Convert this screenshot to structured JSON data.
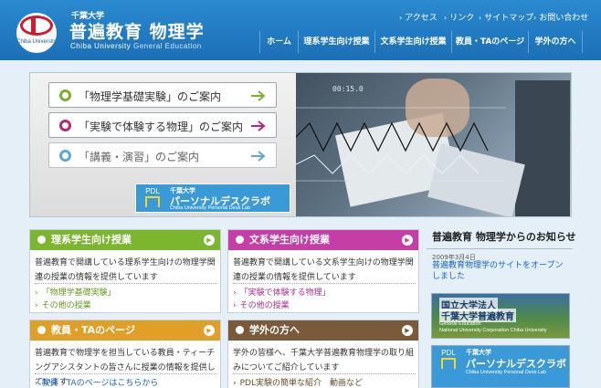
{
  "header": {
    "logo_text": "Chiba University",
    "univ_name": "千葉大学",
    "title": "普遍教育  物理学",
    "subtitle_en": "Chiba University",
    "subtitle_en2": "General Education",
    "util_links": [
      "アクセス",
      "リンク",
      "サイトマップ",
      "お問い合わせ"
    ],
    "nav": [
      "ホーム",
      "理系学生向け授業",
      "文系学生向け授業",
      "教員・TAのページ",
      "学外の方へ"
    ]
  },
  "hero": {
    "buttons": [
      {
        "label": "「物理学基礎実験」のご案内",
        "color": "#7ab02e"
      },
      {
        "label": "「実験で体験する物理」のご案内",
        "color": "#b4287a"
      },
      {
        "label": "「講義・演習」のご案内",
        "color": "#5aa8d8"
      }
    ],
    "pdl": {
      "logo": "PDL",
      "small": "千葉大学",
      "big": "パーソナルデスクラボ",
      "en": "Chiba University Personal Desk Lab"
    },
    "photo_readout": "00:15.0"
  },
  "boxes": [
    {
      "title": "理系学生向け授業",
      "color": "#7cb52e",
      "text": "普遍教育で開講している理系学生向けの物理学関連の授業の情報を提供しています",
      "links": [
        "「物理学基礎実験」",
        "その他の授業"
      ]
    },
    {
      "title": "文系学生向け授業",
      "color": "#c43ea6",
      "text": "普遍教育で開講している文系学生向けの物理学関連の授業の情報を提供しています",
      "links": [
        "「実験で体験する物理」",
        "その他の授業"
      ]
    },
    {
      "title": "教員・TAのページ",
      "color": "#e0a028",
      "text": "普遍教育で物理学を担当している教員・ティーチングアシスタントの皆さんに授業の情報を提供しています",
      "links": [
        "教員・TAのページはこちらから"
      ]
    },
    {
      "title": "学外の方へ",
      "color": "#7a5a3a",
      "text": "学外の皆様へ、千葉大学普遍教育物理学の取り組みについてご紹介しています",
      "links": [
        "PDL実験の簡単な紹介　動画など"
      ]
    }
  ],
  "news": {
    "heading": "普遍教育 物理学からのお知らせ",
    "date": "2009年3月4日",
    "link": "普遍教育物理学のサイトをオープンしました"
  },
  "banners": {
    "b1_line1": "国立大学法人",
    "b1_line2": "千葉大学普遍教育",
    "b1_en1": "General Education",
    "b1_en2": "National University Corporation Chiba University"
  }
}
